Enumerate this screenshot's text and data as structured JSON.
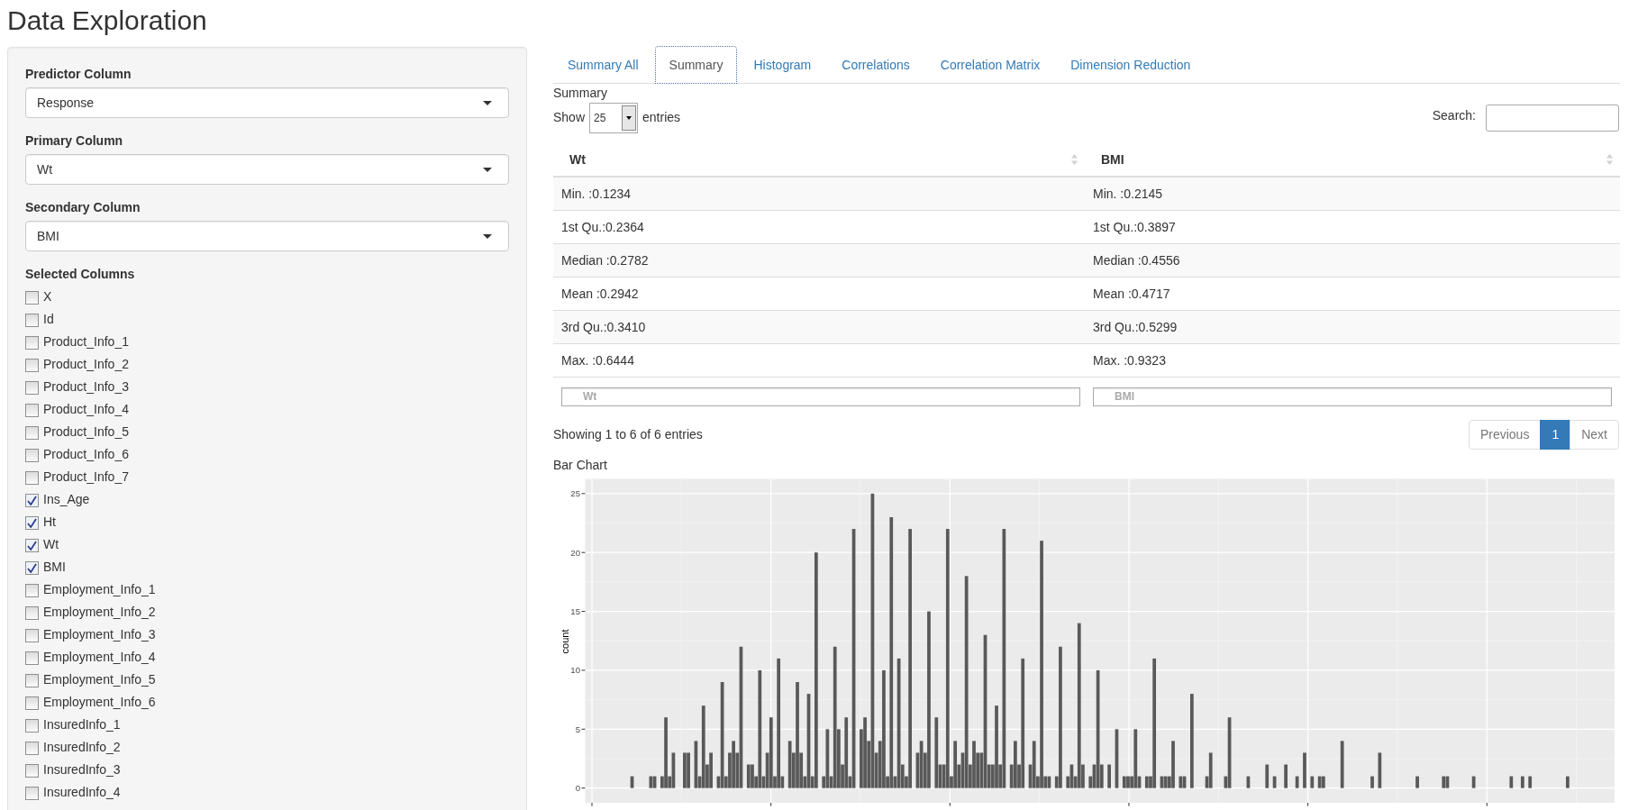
{
  "page": {
    "title": "Data Exploration"
  },
  "sidebar": {
    "selects": [
      {
        "label": "Predictor Column",
        "value": "Response"
      },
      {
        "label": "Primary Column",
        "value": "Wt"
      },
      {
        "label": "Secondary Column",
        "value": "BMI"
      }
    ],
    "column_picker": {
      "label": "Selected Columns",
      "items": [
        {
          "label": "X",
          "checked": false
        },
        {
          "label": "Id",
          "checked": false
        },
        {
          "label": "Product_Info_1",
          "checked": false
        },
        {
          "label": "Product_Info_2",
          "checked": false
        },
        {
          "label": "Product_Info_3",
          "checked": false
        },
        {
          "label": "Product_Info_4",
          "checked": false
        },
        {
          "label": "Product_Info_5",
          "checked": false
        },
        {
          "label": "Product_Info_6",
          "checked": false
        },
        {
          "label": "Product_Info_7",
          "checked": false
        },
        {
          "label": "Ins_Age",
          "checked": true
        },
        {
          "label": "Ht",
          "checked": true
        },
        {
          "label": "Wt",
          "checked": true
        },
        {
          "label": "BMI",
          "checked": true
        },
        {
          "label": "Employment_Info_1",
          "checked": false
        },
        {
          "label": "Employment_Info_2",
          "checked": false
        },
        {
          "label": "Employment_Info_3",
          "checked": false
        },
        {
          "label": "Employment_Info_4",
          "checked": false
        },
        {
          "label": "Employment_Info_5",
          "checked": false
        },
        {
          "label": "Employment_Info_6",
          "checked": false
        },
        {
          "label": "InsuredInfo_1",
          "checked": false
        },
        {
          "label": "InsuredInfo_2",
          "checked": false
        },
        {
          "label": "InsuredInfo_3",
          "checked": false
        },
        {
          "label": "InsuredInfo_4",
          "checked": false
        }
      ]
    }
  },
  "tabs": [
    {
      "label": "Summary All",
      "selected": false
    },
    {
      "label": "Summary",
      "selected": true
    },
    {
      "label": "Histogram",
      "selected": false
    },
    {
      "label": "Correlations",
      "selected": false
    },
    {
      "label": "Correlation Matrix",
      "selected": false
    },
    {
      "label": "Dimension Reduction",
      "selected": false
    }
  ],
  "summary": {
    "caption": "Summary",
    "length_menu": {
      "label_before": "Show",
      "value": "25",
      "label_after": "entries"
    },
    "search": {
      "label": "Search:"
    },
    "table": {
      "columns": [
        {
          "label": "Wt"
        },
        {
          "label": "BMI"
        }
      ],
      "rows": [
        [
          "Min. :0.1234",
          "Min. :0.2145"
        ],
        [
          "1st Qu.:0.2364",
          "1st Qu.:0.3897"
        ],
        [
          "Median :0.2782",
          "Median :0.4556"
        ],
        [
          "Mean :0.2942",
          "Mean :0.4717"
        ],
        [
          "3rd Qu.:0.3410",
          "3rd Qu.:0.5299"
        ],
        [
          "Max. :0.6444",
          "Max. :0.9323"
        ]
      ],
      "filters": [
        {
          "placeholder": "Wt"
        },
        {
          "placeholder": "BMI"
        }
      ]
    },
    "info": "Showing 1 to 6 of 6 entries",
    "pagination": [
      {
        "label": "Previous",
        "selected": false,
        "disabled": true
      },
      {
        "label": "1",
        "selected": true,
        "disabled": false
      },
      {
        "label": "Next",
        "selected": false,
        "disabled": true
      }
    ]
  },
  "bar_chart": {
    "caption": "Bar Chart",
    "chart_data": {
      "type": "bar",
      "ylabel": "count",
      "grid": true,
      "ylim": [
        -1.25,
        26.25
      ],
      "yticks": [
        0,
        5,
        10,
        15,
        20,
        25
      ],
      "categories": [
        null,
        null,
        null,
        null,
        null,
        null,
        null,
        null,
        null,
        null,
        null,
        null,
        null,
        null,
        null,
        null,
        null,
        null,
        null,
        null,
        null,
        null,
        null,
        null,
        null,
        null,
        null,
        null,
        null,
        null,
        null,
        null,
        null,
        null,
        null,
        null,
        null,
        null,
        null,
        null,
        null,
        null,
        null,
        null,
        null,
        null,
        null,
        null,
        null,
        null,
        null,
        null,
        null,
        null,
        null,
        null,
        null,
        null,
        null,
        null,
        null,
        null,
        null,
        null,
        null,
        null,
        null,
        null,
        null,
        null,
        null,
        null,
        null,
        null,
        null,
        null,
        null,
        null,
        null,
        null,
        null,
        null,
        null,
        null,
        null,
        null,
        null,
        null,
        null,
        null,
        null,
        null,
        null,
        null,
        null,
        null,
        null,
        null,
        null,
        null,
        null,
        null,
        null,
        null,
        null,
        null,
        null,
        null,
        null,
        null,
        null,
        null,
        null,
        null,
        null,
        null,
        null,
        null,
        null,
        null,
        null,
        null,
        null,
        null,
        null,
        null,
        null,
        null,
        null,
        null,
        null,
        null,
        null,
        null,
        null,
        null,
        null,
        null,
        null,
        null,
        null,
        null,
        null,
        null,
        null,
        null,
        null,
        null,
        null,
        null,
        null,
        null,
        null,
        null,
        null,
        null,
        null,
        null,
        null,
        null,
        null,
        null,
        null,
        null,
        null,
        null,
        null,
        null,
        null,
        null,
        null,
        null,
        null,
        null,
        null,
        null,
        null,
        null,
        null,
        null,
        null,
        null,
        null,
        null,
        null,
        null,
        null,
        null,
        null,
        null,
        null,
        null,
        null,
        null,
        null,
        null,
        null,
        null,
        null,
        null,
        null,
        null,
        null,
        null,
        null,
        null,
        null,
        null,
        null,
        null,
        null,
        null,
        null,
        null,
        null,
        null,
        null,
        null,
        null,
        null,
        null,
        null,
        null,
        null,
        null,
        null,
        null,
        null,
        null,
        null,
        null,
        null,
        null,
        null,
        null,
        null,
        null,
        null,
        null,
        null,
        null,
        null,
        null,
        null,
        null,
        null,
        null,
        null,
        null,
        null,
        null,
        null,
        null,
        null,
        null,
        null,
        null,
        null,
        null,
        null,
        null,
        null,
        null,
        null,
        null,
        null,
        null,
        null,
        null,
        null,
        null,
        null,
        null,
        null
      ],
      "values": [
        0,
        0,
        0,
        0,
        0,
        0,
        0,
        0,
        0,
        0,
        0,
        0,
        1,
        0,
        0,
        0,
        0,
        1,
        1,
        0,
        1,
        6,
        1,
        3,
        0,
        0,
        3,
        3,
        0,
        4,
        1,
        7,
        2,
        3,
        0,
        1,
        9,
        1,
        3,
        4,
        3,
        12,
        0,
        2,
        2,
        1,
        10,
        1,
        3,
        6,
        1,
        11,
        1,
        0,
        4,
        3,
        9,
        3,
        1,
        8,
        1,
        20,
        0,
        1,
        5,
        1,
        12,
        5,
        2,
        6,
        1,
        22,
        0,
        5,
        6,
        4,
        25,
        3,
        4,
        10,
        1,
        23,
        1,
        11,
        2,
        1,
        22,
        0,
        3,
        4,
        3,
        15,
        0,
        6,
        2,
        2,
        22,
        1,
        4,
        2,
        3,
        18,
        2,
        4,
        3,
        3,
        13,
        2,
        2,
        7,
        2,
        22,
        0,
        2,
        4,
        2,
        11,
        0,
        2,
        4,
        1,
        21,
        1,
        1,
        0,
        1,
        12,
        0,
        1,
        2,
        1,
        14,
        2,
        0,
        1,
        2,
        10,
        2,
        0,
        2,
        0,
        5,
        0,
        1,
        1,
        1,
        5,
        1,
        0,
        1,
        1,
        11,
        0,
        1,
        1,
        1,
        4,
        0,
        1,
        1,
        0,
        8,
        0,
        0,
        0,
        1,
        3,
        0,
        0,
        0,
        1,
        6,
        0,
        0,
        0,
        0,
        1,
        0,
        0,
        0,
        0,
        2,
        0,
        1,
        0,
        0,
        2,
        0,
        0,
        1,
        0,
        3,
        0,
        1,
        0,
        1,
        1,
        0,
        0,
        0,
        0,
        4,
        0,
        0,
        0,
        0,
        0,
        0,
        0,
        1,
        0,
        3,
        0,
        0,
        0,
        0,
        0,
        0,
        0,
        0,
        0,
        1,
        0,
        0,
        0,
        0,
        0,
        0,
        1,
        1,
        0,
        0,
        0,
        0,
        0,
        0,
        1,
        0,
        0,
        0,
        0,
        0,
        0,
        0,
        0,
        0,
        1,
        0,
        0,
        1,
        0,
        1,
        0,
        0,
        0,
        0,
        0,
        0,
        0,
        0,
        0,
        1,
        0,
        0,
        0,
        0,
        0,
        0,
        0,
        0,
        0,
        0,
        0,
        0
      ]
    }
  }
}
